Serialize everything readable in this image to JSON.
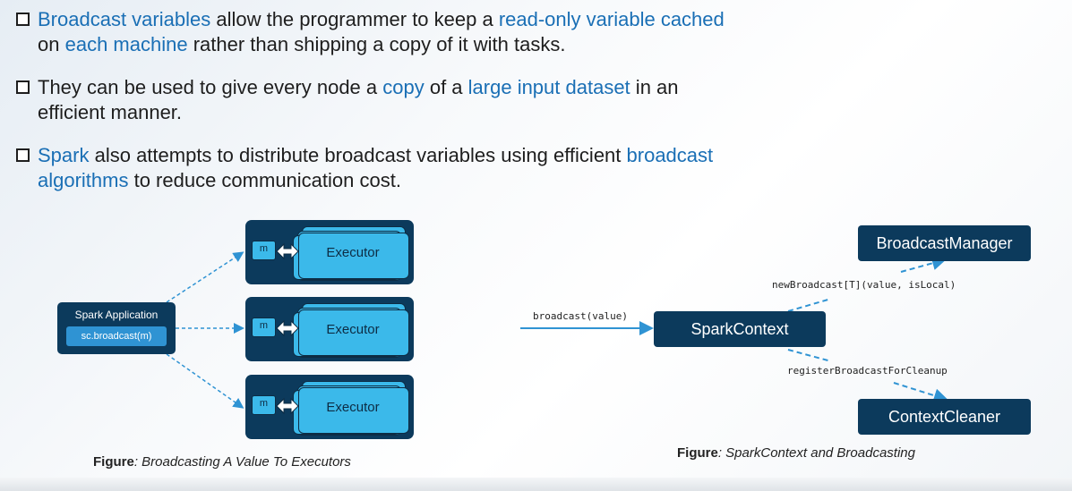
{
  "bullets": [
    {
      "segments": [
        {
          "text": "Broadcast variables",
          "hl": true
        },
        {
          "text": " allow the programmer to keep a ",
          "hl": false
        },
        {
          "text": "read-only variable cached",
          "hl": true
        },
        {
          "text": "\non ",
          "hl": false
        },
        {
          "text": "each machine",
          "hl": true
        },
        {
          "text": " rather than shipping a copy of it with tasks.",
          "hl": false
        }
      ]
    },
    {
      "segments": [
        {
          "text": "They can be used to give every node a ",
          "hl": false
        },
        {
          "text": "copy",
          "hl": true
        },
        {
          "text": " of a ",
          "hl": false
        },
        {
          "text": "large input dataset",
          "hl": true
        },
        {
          "text": " in an\nefficient manner.",
          "hl": false
        }
      ]
    },
    {
      "segments": [
        {
          "text": "Spark",
          "hl": true
        },
        {
          "text": " also attempts to distribute broadcast variables using efficient ",
          "hl": false
        },
        {
          "text": "broadcast\nalgorithms",
          "hl": true
        },
        {
          "text": " to reduce communication cost.",
          "hl": false
        }
      ]
    }
  ],
  "left_diagram": {
    "app_title": "Spark Application",
    "app_code": "sc.broadcast(m)",
    "executors": [
      {
        "m_label": "m",
        "label": "Executor"
      },
      {
        "m_label": "m",
        "label": "Executor"
      },
      {
        "m_label": "m",
        "label": "Executor"
      }
    ],
    "caption_bold": "Figure",
    "caption_italic": ": Broadcasting A Value To Executors"
  },
  "right_diagram": {
    "spark_context": "SparkContext",
    "broadcast_manager": "BroadcastManager",
    "context_cleaner": "ContextCleaner",
    "broadcast_call": "broadcast(value)",
    "new_broadcast_call": "newBroadcast[T](value, isLocal)",
    "register_call": "registerBroadcastForCleanup",
    "caption_bold": "Figure",
    "caption_italic": ": SparkContext and Broadcasting"
  },
  "colors": {
    "panel": "#0c3a5c",
    "accent": "#2f93d3",
    "executor_fill": "#3bb9ea",
    "highlight_text": "#1a6fb5"
  }
}
